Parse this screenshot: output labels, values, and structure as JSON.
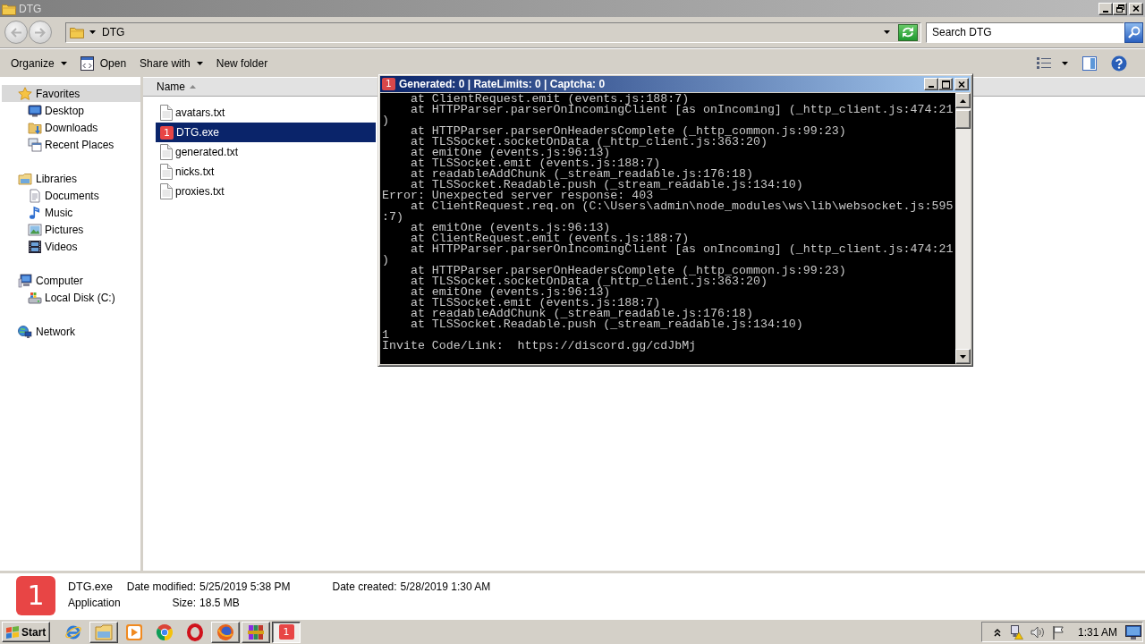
{
  "window": {
    "title": "DTG"
  },
  "navigation_buttons": [
    {
      "kind": "back",
      "disabled": true
    },
    {
      "kind": "forward",
      "disabled": true
    }
  ],
  "address_bar": {
    "path": [
      "DTG"
    ]
  },
  "search": {
    "placeholder": "Search DTG"
  },
  "toolbar": [
    {
      "label": "Organize",
      "kind": "menu"
    },
    {
      "label": "Open",
      "kind": "open"
    },
    {
      "label": "Share with",
      "kind": "menu"
    },
    {
      "label": "New folder",
      "kind": "plain"
    }
  ],
  "navigation": [
    {
      "label": "Favorites",
      "kind": "favorites",
      "selected": true,
      "children": [
        {
          "label": "Desktop",
          "kind": "desktop",
          "selected": false
        },
        {
          "label": "Downloads",
          "kind": "downloads",
          "selected": false
        },
        {
          "label": "Recent Places",
          "kind": "recent",
          "selected": false
        }
      ]
    },
    {
      "label": "Libraries",
      "kind": "libraries",
      "selected": false,
      "children": [
        {
          "label": "Documents",
          "kind": "documents",
          "selected": false
        },
        {
          "label": "Music",
          "kind": "music",
          "selected": false
        },
        {
          "label": "Pictures",
          "kind": "pictures",
          "selected": false
        },
        {
          "label": "Videos",
          "kind": "videos",
          "selected": false
        }
      ]
    },
    {
      "label": "Computer",
      "kind": "computer",
      "selected": false,
      "children": [
        {
          "label": "Local Disk (C:)",
          "kind": "disk",
          "selected": false
        }
      ]
    },
    {
      "label": "Network",
      "kind": "network",
      "selected": false
    }
  ],
  "file_list": {
    "columns": [
      {
        "label": "Name",
        "sorted": true
      }
    ],
    "files": [
      {
        "name": "avatars.txt",
        "kind": "text",
        "selected": false
      },
      {
        "name": "DTG.exe",
        "kind": "app",
        "icon_text": "1",
        "selected": true
      },
      {
        "name": "generated.txt",
        "kind": "text",
        "selected": false
      },
      {
        "name": "nicks.txt",
        "kind": "text",
        "selected": false
      },
      {
        "name": "proxies.txt",
        "kind": "text",
        "selected": false
      }
    ]
  },
  "console": {
    "icon_text": "1",
    "title": "Generated: 0 | RateLimits: 0 | Captcha: 0",
    "lines": [
      "    at ClientRequest.emit (events.js:188:7)",
      "    at HTTPParser.parserOnIncomingClient [as onIncoming] (_http_client.js:474:21",
      ")",
      "    at HTTPParser.parserOnHeadersComplete (_http_common.js:99:23)",
      "    at TLSSocket.socketOnData (_http_client.js:363:20)",
      "    at emitOne (events.js:96:13)",
      "    at TLSSocket.emit (events.js:188:7)",
      "    at readableAddChunk (_stream_readable.js:176:18)",
      "    at TLSSocket.Readable.push (_stream_readable.js:134:10)",
      "Error: Unexpected server response: 403",
      "    at ClientRequest.req.on (C:\\Users\\admin\\node_modules\\ws\\lib\\websocket.js:595",
      ":7)",
      "    at emitOne (events.js:96:13)",
      "    at ClientRequest.emit (events.js:188:7)",
      "    at HTTPParser.parserOnIncomingClient [as onIncoming] (_http_client.js:474:21",
      ")",
      "    at HTTPParser.parserOnHeadersComplete (_http_common.js:99:23)",
      "    at TLSSocket.socketOnData (_http_client.js:363:20)",
      "    at emitOne (events.js:96:13)",
      "    at TLSSocket.emit (events.js:188:7)",
      "    at readableAddChunk (_stream_readable.js:176:18)",
      "    at TLSSocket.Readable.push (_stream_readable.js:134:10)",
      "1",
      "Invite Code/Link:  https://discord.gg/cdJbMj"
    ]
  },
  "details": {
    "icon_text": "1",
    "name": "DTG.exe",
    "type": "Application",
    "properties": [
      {
        "label": "Date modified:",
        "value": "5/25/2019 5:38 PM"
      },
      {
        "label": "Size:",
        "value": "18.5 MB"
      },
      {
        "label": "Date created:",
        "value": "5/28/2019 1:30 AM"
      }
    ]
  },
  "taskbar": {
    "start": "Start",
    "apps": [
      {
        "kind": "ie",
        "open": false,
        "selected": false
      },
      {
        "kind": "explorer",
        "open": true,
        "selected": false
      },
      {
        "kind": "media",
        "open": false,
        "selected": false
      },
      {
        "kind": "chrome",
        "open": false,
        "selected": false
      },
      {
        "kind": "opera",
        "open": false,
        "selected": false
      },
      {
        "kind": "firefox",
        "open": true,
        "selected": false
      },
      {
        "kind": "winrar",
        "open": true,
        "selected": false
      },
      {
        "kind": "app",
        "icon_text": "1",
        "open": true,
        "selected": true
      }
    ],
    "clock": "1:31 AM"
  }
}
